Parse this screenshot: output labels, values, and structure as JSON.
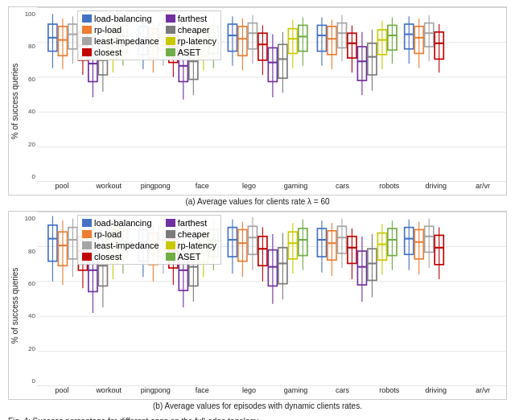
{
  "charts": [
    {
      "id": "chart-a",
      "caption": "(a) Average values for clients rate λ = 60",
      "y_label": "% of success queries",
      "y_ticks": [
        "100",
        "80",
        "60",
        "40",
        "20",
        "0"
      ],
      "x_labels": [
        "pool",
        "workout",
        "pingpong",
        "face",
        "lego",
        "gaming",
        "cars",
        "robots",
        "driving",
        "ar/vr"
      ]
    },
    {
      "id": "chart-b",
      "caption": "(b) Average values for episodes with dynamic clients rates.",
      "y_label": "% of success queries",
      "y_ticks": [
        "100",
        "80",
        "60",
        "40",
        "20",
        "0"
      ],
      "x_labels": [
        "pool",
        "workout",
        "pingpong",
        "face",
        "lego",
        "gaming",
        "cars",
        "robots",
        "driving",
        "ar/vr"
      ]
    }
  ],
  "legend": {
    "col1": [
      {
        "label": "load-balancing",
        "color": "#4472C4"
      },
      {
        "label": "rp-load",
        "color": "#ED7D31"
      },
      {
        "label": "least-impedance",
        "color": "#A5A5A5"
      },
      {
        "label": "closest",
        "color": "#C00000"
      }
    ],
    "col2": [
      {
        "label": "farthest",
        "color": "#7030A0"
      },
      {
        "label": "cheaper",
        "color": "#7B7B7B"
      },
      {
        "label": "rp-latency",
        "color": "#C9C900"
      },
      {
        "label": "ASET",
        "color": "#70AD47"
      }
    ]
  },
  "fig_caption": "Fig. 4: Success percentage for different apps on the full-edge topology"
}
